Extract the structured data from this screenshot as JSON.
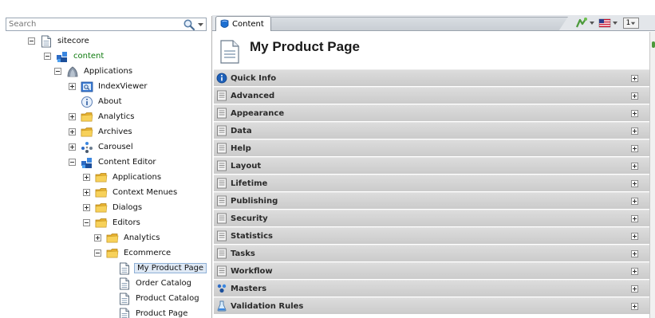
{
  "search": {
    "placeholder": "Search"
  },
  "tree": [
    {
      "label": "sitecore",
      "icon": "document-icon",
      "expanded": true,
      "depth": 0
    },
    {
      "label": "content",
      "icon": "content-icon",
      "expanded": true,
      "depth": 1
    },
    {
      "label": "Applications",
      "icon": "applications-icon",
      "expanded": true,
      "depth": 2
    },
    {
      "label": "IndexViewer",
      "icon": "index-viewer-icon",
      "expanded": false,
      "depth": 3
    },
    {
      "label": "About",
      "icon": "info-icon",
      "expanded": null,
      "depth": 3
    },
    {
      "label": "Analytics",
      "icon": "folder-icon",
      "expanded": false,
      "depth": 3
    },
    {
      "label": "Archives",
      "icon": "folder-icon",
      "expanded": false,
      "depth": 3
    },
    {
      "label": "Carousel",
      "icon": "carousel-icon",
      "expanded": false,
      "depth": 3
    },
    {
      "label": "Content Editor",
      "icon": "content-icon",
      "expanded": true,
      "depth": 3
    },
    {
      "label": "Applications",
      "icon": "folder-icon",
      "expanded": false,
      "depth": 4
    },
    {
      "label": "Context Menues",
      "icon": "folder-icon",
      "expanded": false,
      "depth": 4
    },
    {
      "label": "Dialogs",
      "icon": "folder-icon",
      "expanded": false,
      "depth": 4
    },
    {
      "label": "Editors",
      "icon": "folder-icon",
      "expanded": true,
      "depth": 4
    },
    {
      "label": "Analytics",
      "icon": "folder-icon",
      "expanded": false,
      "depth": 5
    },
    {
      "label": "Ecommerce",
      "icon": "folder-icon",
      "expanded": true,
      "depth": 5
    },
    {
      "label": "My Product Page",
      "icon": "document-icon",
      "expanded": null,
      "depth": 6,
      "selected": true
    },
    {
      "label": "Order Catalog",
      "icon": "document-icon",
      "expanded": null,
      "depth": 6
    },
    {
      "label": "Product Catalog",
      "icon": "document-icon",
      "expanded": null,
      "depth": 6
    },
    {
      "label": "Product Page",
      "icon": "document-icon",
      "expanded": null,
      "depth": 6
    }
  ],
  "tabs": {
    "content_label": "Content",
    "language": "1"
  },
  "editor": {
    "title": "My Product Page"
  },
  "sections": [
    {
      "title": "Quick Info",
      "icon": "info-circle-icon"
    },
    {
      "title": "Advanced",
      "icon": "section-icon"
    },
    {
      "title": "Appearance",
      "icon": "section-icon"
    },
    {
      "title": "Data",
      "icon": "section-icon"
    },
    {
      "title": "Help",
      "icon": "section-icon"
    },
    {
      "title": "Layout",
      "icon": "section-icon"
    },
    {
      "title": "Lifetime",
      "icon": "section-icon"
    },
    {
      "title": "Publishing",
      "icon": "section-icon"
    },
    {
      "title": "Security",
      "icon": "section-icon"
    },
    {
      "title": "Statistics",
      "icon": "section-icon"
    },
    {
      "title": "Tasks",
      "icon": "section-icon"
    },
    {
      "title": "Workflow",
      "icon": "section-icon"
    },
    {
      "title": "Masters",
      "icon": "masters-icon"
    },
    {
      "title": "Validation Rules",
      "icon": "validation-icon"
    }
  ],
  "colors": {
    "accent_blue": "#1c5fb8",
    "folder_yellow": "#f3c94a",
    "content_green": "#0d7a0d",
    "section_bg": "#d4d4d4"
  }
}
